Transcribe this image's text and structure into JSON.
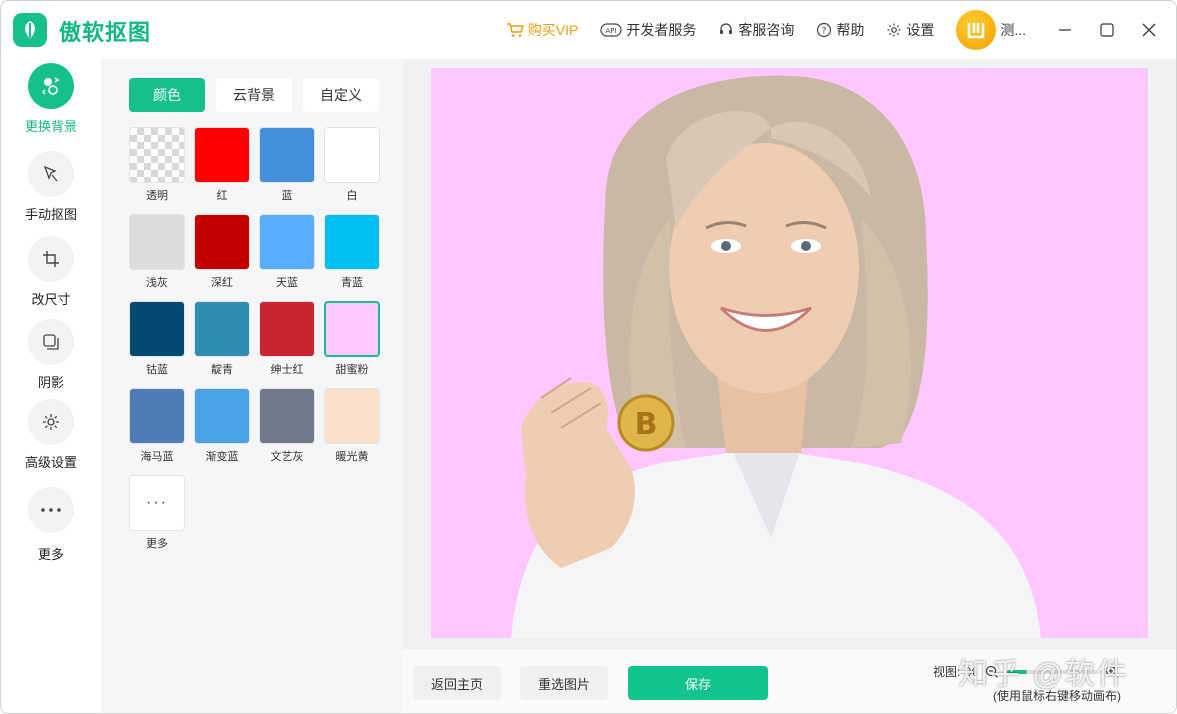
{
  "app": {
    "title": "傲软抠图"
  },
  "titlebar": {
    "vip": "购买VIP",
    "developer": "开发者服务",
    "support": "客服咨询",
    "help": "帮助",
    "settings": "设置",
    "username": "测..."
  },
  "nav": [
    {
      "label": "更换背景",
      "icon": "replace-background-icon",
      "active": true
    },
    {
      "label": "手动抠图",
      "icon": "manual-cutout-icon"
    },
    {
      "label": "改尺寸",
      "icon": "crop-icon"
    },
    {
      "label": "阴影",
      "icon": "shadow-icon"
    },
    {
      "label": "高级设置",
      "icon": "advanced-settings-icon"
    },
    {
      "label": "更多",
      "icon": "more-icon"
    }
  ],
  "tabs": [
    "颜色",
    "云背景",
    "自定义"
  ],
  "swatches": [
    {
      "label": "透明",
      "color": "transparent"
    },
    {
      "label": "红",
      "color": "#ff0000"
    },
    {
      "label": "蓝",
      "color": "#438fd9"
    },
    {
      "label": "白",
      "color": "#ffffff"
    },
    {
      "label": "浅灰",
      "color": "#dcdcdf"
    },
    {
      "label": "深红",
      "color": "#c50000"
    },
    {
      "label": "天蓝",
      "color": "#59adff"
    },
    {
      "label": "青蓝",
      "color": "#00bff3"
    },
    {
      "label": "钴蓝",
      "color": "#034a72"
    },
    {
      "label": "靛青",
      "color": "#2f8db4"
    },
    {
      "label": "绅士红",
      "color": "#c8252f"
    },
    {
      "label": "甜蜜粉",
      "color": "#ffc6ff",
      "selected": true
    },
    {
      "label": "海马蓝",
      "color": "#4f7cb5"
    },
    {
      "label": "渐变蓝",
      "color": "#47a3e4"
    },
    {
      "label": "文艺灰",
      "color": "#6f7a8d"
    },
    {
      "label": "暖光黄",
      "color": "#fbe0cb"
    },
    {
      "label": "更多",
      "color": "more"
    }
  ],
  "canvas": {
    "background": "#ffc6ff"
  },
  "bottom": {
    "back": "返回主页",
    "reselect": "重选图片",
    "save": "保存",
    "zoom_label": "视图:",
    "zoom_value": "%",
    "hint": "(使用鼠标右键移动画布)",
    "watermark": "知乎 @软件"
  },
  "colors": {
    "accent": "#16c08a",
    "vip": "#f39c12"
  }
}
